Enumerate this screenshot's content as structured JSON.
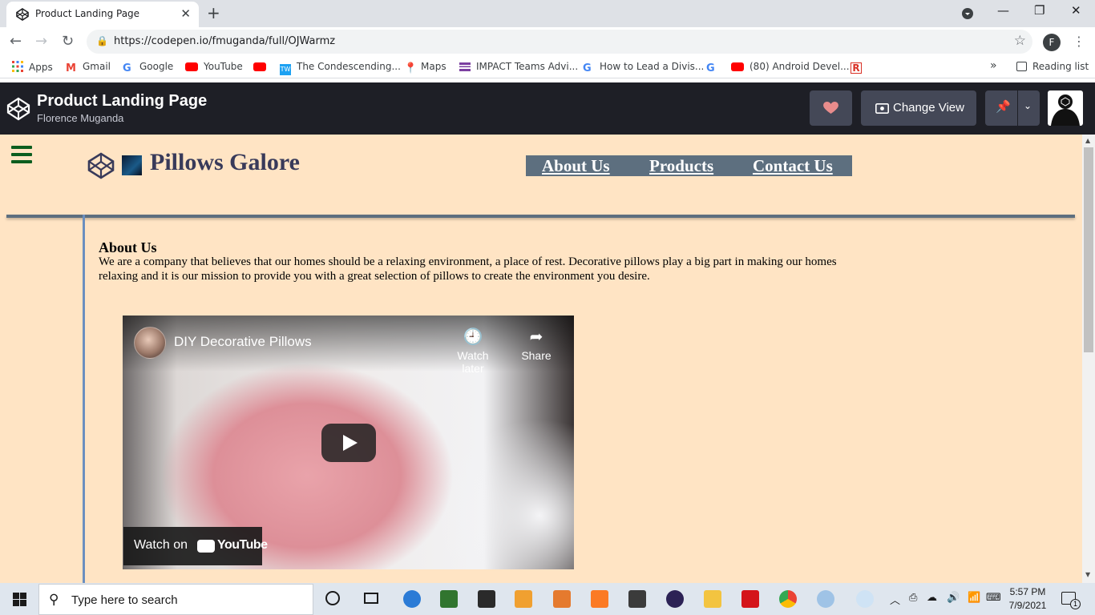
{
  "browser": {
    "tab_title": "Product Landing Page",
    "url": "https://codepen.io/fmuganda/full/OJWarmz",
    "profile_initial": "F",
    "bookmarks": [
      "Apps",
      "Gmail",
      "Google",
      "YouTube",
      "The Condescending...",
      "Maps",
      "IMPACT Teams Advi...",
      "How to Lead a Divis...",
      "(80) Android Devel..."
    ],
    "reading_list": "Reading list"
  },
  "codepen": {
    "title": "Product Landing Page",
    "author": "Florence Muganda",
    "change_view": "Change View"
  },
  "page": {
    "brand": "Pillows Galore",
    "nav": [
      "About Us",
      "Products",
      "Contact Us"
    ],
    "about_heading": "About Us",
    "about_text": "We are a company that believes that our homes should be a relaxing environment, a place of rest. Decorative pillows play a big part in making our homes relaxing and it is our mission to provide you with a great selection of pillows to create the environment you desire."
  },
  "video": {
    "title": "DIY Decorative Pillows",
    "watch_later": "Watch later",
    "share": "Share",
    "watch_on": "Watch on",
    "youtube": "YouTube"
  },
  "taskbar": {
    "search_placeholder": "Type here to search",
    "time": "5:57 PM",
    "date": "7/9/2021",
    "notification_count": "1"
  },
  "colors": {
    "page_bg": "#ffe4c4",
    "nav_bg": "#5d6f7f",
    "codepen_header": "#1e1f26",
    "heart": "#e88c8c",
    "hamburger": "#0b5d1e"
  }
}
